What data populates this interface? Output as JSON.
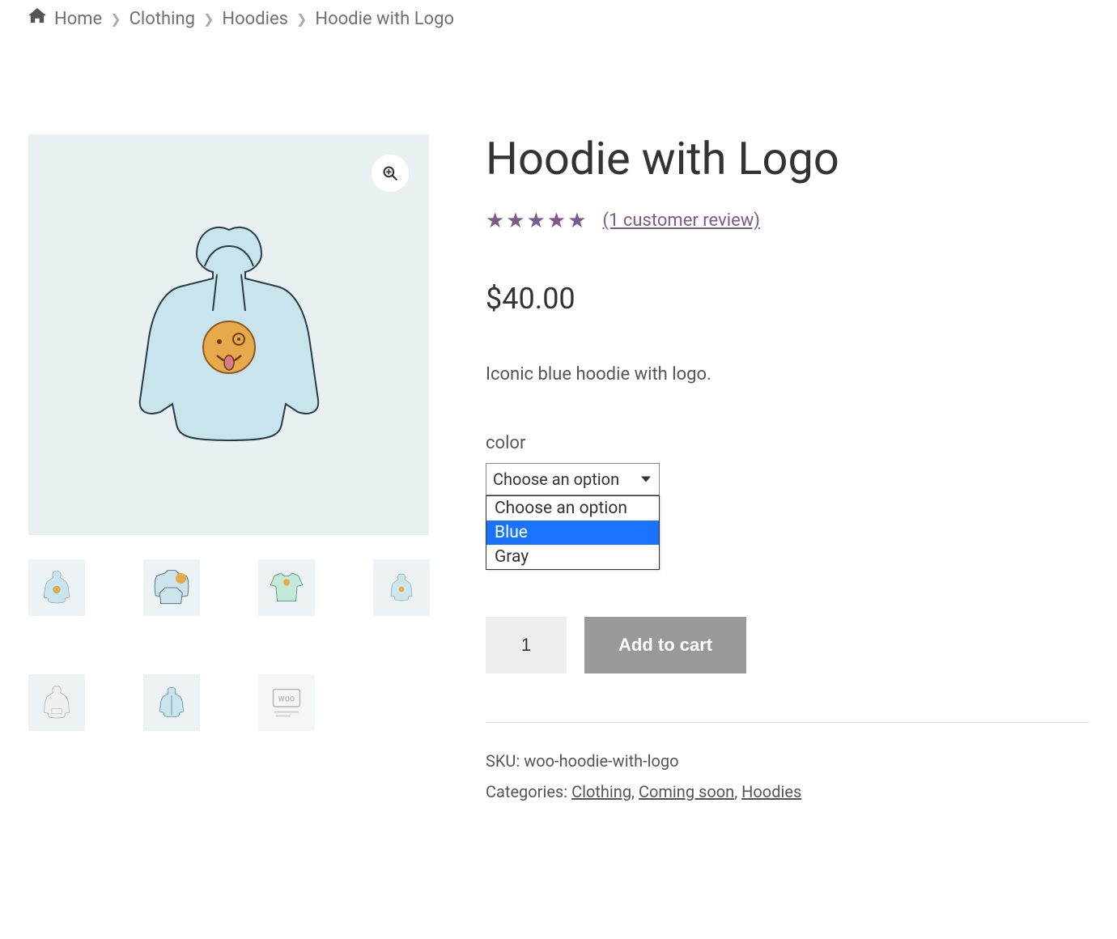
{
  "breadcrumb": {
    "home": "Home",
    "clothing": "Clothing",
    "hoodies": "Hoodies",
    "current": "Hoodie with Logo"
  },
  "product": {
    "title": "Hoodie with Logo",
    "rating_stars": "★★★★★",
    "review_link": "(1 customer review)",
    "price": "$40.00",
    "description": "Iconic blue hoodie with logo.",
    "variation_label": "color",
    "select_placeholder": "Choose an option",
    "options": {
      "opt0": "Choose an option",
      "opt1": "Blue",
      "opt2": "Gray"
    },
    "quantity": "1",
    "add_to_cart": "Add to cart"
  },
  "meta": {
    "sku_label": "SKU: ",
    "sku": "woo-hoodie-with-logo",
    "categories_label": "Categories: ",
    "cat_clothing": "Clothing",
    "cat_coming": "Coming soon",
    "cat_hoodies": "Hoodies"
  }
}
